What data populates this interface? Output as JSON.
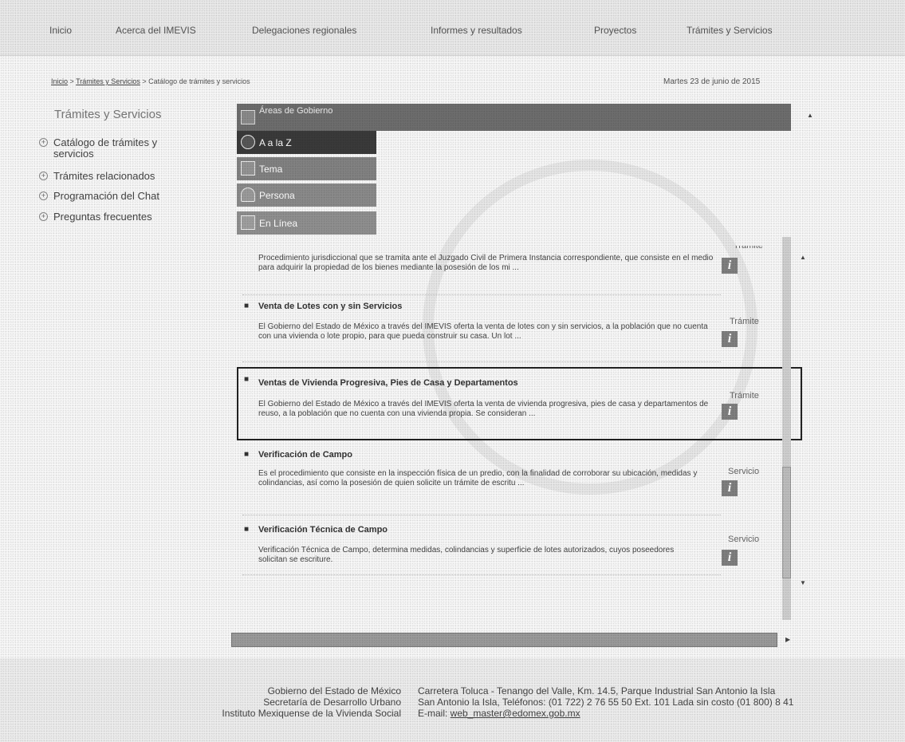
{
  "nav": {
    "items": [
      "Inicio",
      "Acerca del IMEVIS",
      "Delegaciones regionales",
      "Informes y resultados",
      "Proyectos",
      "Trámites y Servicios"
    ]
  },
  "breadcrumb": {
    "home": "Inicio",
    "sep1": ">",
    "section": "Trámites y Servicios",
    "sep2": ">",
    "current": "Catálogo de trámites y servicios"
  },
  "date": "Martes 23 de junio de 2015",
  "sidebar": {
    "title": "Trámites y Servicios",
    "items": [
      "Catálogo de trámites y servicios",
      "Trámites relacionados",
      "Programación del Chat",
      "Preguntas frecuentes"
    ]
  },
  "categories": {
    "header": "Áreas de Gobierno",
    "items": [
      "A a la Z",
      "Tema",
      "Persona",
      "En Línea"
    ]
  },
  "entries": [
    {
      "title": "",
      "desc": "Procedimiento jurisdiccional que se tramita ante el Juzgado Civil de Primera Instancia correspondiente, que consiste en el medio para adquirir la propiedad de los bienes mediante la posesión de los mi ...",
      "type": "Trámite"
    },
    {
      "title": "Venta de Lotes con y sin Servicios",
      "desc": "El Gobierno del Estado de México a través del IMEVIS oferta la venta de lotes con y sin servicios, a la población que no cuenta con una vivienda o lote propio, para que pueda construir su casa. Un lot ...",
      "type": "Trámite"
    },
    {
      "title": "Ventas de Vivienda Progresiva, Pies de Casa y Departamentos",
      "desc": "El Gobierno del Estado de México a través del IMEVIS oferta la venta de vivienda progresiva, pies de casa y departamentos de reuso, a la población que no cuenta con una vivienda propia. Se consideran ...",
      "type": "Trámite"
    },
    {
      "title": "Verificación de Campo",
      "desc": "Es el procedimiento que consiste en la inspección física de un predio, con la finalidad de corroborar su ubicación, medidas y colindancias, así como la posesión de quien solicite un trámite de escritu ...",
      "type": "Servicio"
    },
    {
      "title": "Verificación Técnica de Campo",
      "desc": "Verificación Técnica de Campo, determina medidas, colindancias y superficie de lotes autorizados, cuyos poseedores solicitan se escriture.",
      "type": "Servicio"
    }
  ],
  "info_glyph": "i",
  "footer": {
    "left": [
      "Gobierno del Estado de México",
      "Secretaría de Desarrollo Urbano",
      "Instituto Mexiquense de la Vivienda Social"
    ],
    "right_line1": "Carretera Toluca - Tenango del Valle, Km. 14.5, Parque Industrial San Antonio la Isla",
    "right_line2": "San Antonio la Isla, Teléfonos: (01 722) 2 76 55 50  Ext. 101 Lada sin costo (01 800) 8 41",
    "email_label": "E-mail: ",
    "email": "web_master@edomex.gob.mx"
  }
}
